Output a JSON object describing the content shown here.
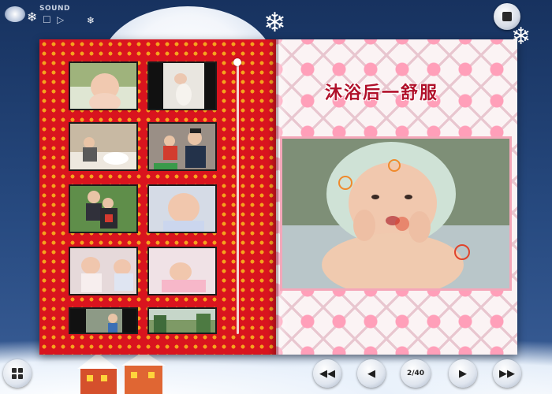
{
  "sound": {
    "label": "SOUND"
  },
  "album": {
    "title": "沐浴后一舒服",
    "page_indicator": "2/40"
  },
  "icons": {
    "sound": "speaker-disc-icon",
    "exit": "stop-icon",
    "grid": "grid-icon",
    "first": "rewind-icon",
    "prev": "prev-icon",
    "next": "next-icon",
    "last": "fast-forward-icon"
  },
  "colors": {
    "left_page_bg": "#d9141e",
    "left_page_dots": "#f5a21d",
    "title": "#b0102a"
  }
}
